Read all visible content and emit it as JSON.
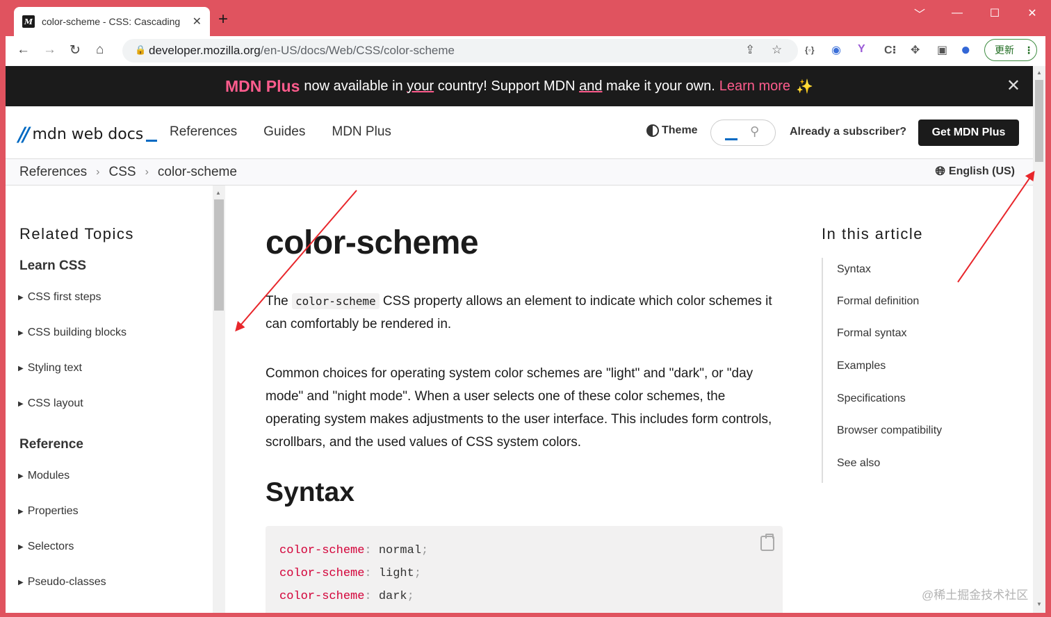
{
  "browser": {
    "tab_title": "color-scheme - CSS: Cascading",
    "new_tab": "+",
    "url_host": "developer.mozilla.org",
    "url_path": "/en-US/docs/Web/CSS/color-scheme",
    "update_label": "更新"
  },
  "promo": {
    "brand": "MDN Plus",
    "t1": "now available in ",
    "u1": "your",
    "t2": " country! Support MDN ",
    "u2": "and",
    "t3": " make it your own.",
    "learn_more": "Learn more"
  },
  "header": {
    "logo_text": "mdn web docs",
    "nav": [
      "References",
      "Guides",
      "MDN Plus"
    ],
    "theme_label": "Theme",
    "subscriber_text": "Already a subscriber?",
    "cta_label": "Get MDN Plus"
  },
  "breadcrumbs": [
    "References",
    "CSS",
    "color-scheme"
  ],
  "language": "English (US)",
  "sidebar": {
    "title": "Related Topics",
    "sections": [
      {
        "heading": "Learn CSS",
        "items": [
          "CSS first steps",
          "CSS building blocks",
          "Styling text",
          "CSS layout"
        ]
      },
      {
        "heading": "Reference",
        "items": [
          "Modules",
          "Properties",
          "Selectors",
          "Pseudo-classes"
        ]
      }
    ]
  },
  "article": {
    "title": "color-scheme",
    "intro_before": "The ",
    "intro_code": "color-scheme",
    "intro_after": " CSS property allows an element to indicate which color schemes it can comfortably be rendered in.",
    "paragraph2": "Common choices for operating system color schemes are \"light\" and \"dark\", or \"day mode\" and \"night mode\". When a user selects one of these color schemes, the operating system makes adjustments to the user interface. This includes form controls, scrollbars, and the used values of CSS system colors.",
    "syntax_heading": "Syntax",
    "code_lines": [
      {
        "prop": "color-scheme",
        "value": "normal"
      },
      {
        "prop": "color-scheme",
        "value": "light"
      },
      {
        "prop": "color-scheme",
        "value": "dark"
      }
    ]
  },
  "toc": {
    "title": "In this article",
    "items": [
      "Syntax",
      "Formal definition",
      "Formal syntax",
      "Examples",
      "Specifications",
      "Browser compatibility",
      "See also"
    ]
  },
  "watermark": "@稀土掘金技术社区",
  "colors": {
    "chrome_frame": "#e0535f",
    "mdn_blue": "#0069c2",
    "mdn_plus_pink": "#ff5c8d",
    "annotation_red": "#e8262b"
  }
}
